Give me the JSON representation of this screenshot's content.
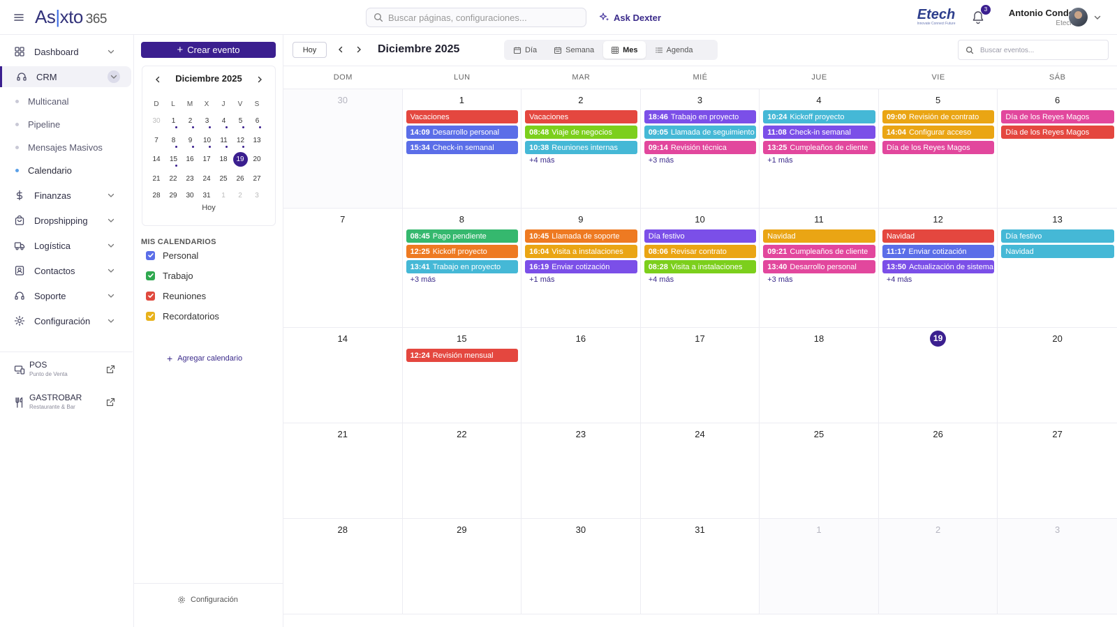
{
  "app": {
    "logo_main": "As",
    "logo_bar": "|",
    "logo_rest": "xto",
    "logo_suffix": "365",
    "search_placeholder": "Buscar páginas, configuraciones...",
    "ask_label": "Ask Dexter",
    "brand_name": "Etech",
    "brand_tagline": "Innovate Connect Future",
    "notifications": "3",
    "user_name": "Antonio Conde",
    "user_company": "Etech"
  },
  "sidebar": {
    "items": [
      {
        "label": "Dashboard",
        "icon": "dashboard-icon"
      },
      {
        "label": "CRM",
        "icon": "headset-icon"
      },
      {
        "label": "Finanzas",
        "icon": "dollar-icon"
      },
      {
        "label": "Dropshipping",
        "icon": "bag-icon"
      },
      {
        "label": "Logística",
        "icon": "truck-icon"
      },
      {
        "label": "Contactos",
        "icon": "contacts-icon"
      },
      {
        "label": "Soporte",
        "icon": "headset-icon"
      },
      {
        "label": "Configuración",
        "icon": "gear-icon"
      }
    ],
    "crm_sub": [
      "Multicanal",
      "Pipeline",
      "Mensajes Masivos",
      "Calendario"
    ],
    "external": [
      {
        "title": "POS",
        "subtitle": "Punto de Venta"
      },
      {
        "title": "GASTROBAR",
        "subtitle": "Restaurante & Bar"
      }
    ]
  },
  "calendar_panel": {
    "create_label": "Crear evento",
    "mini_title": "Diciembre 2025",
    "weekdays": [
      "D",
      "L",
      "M",
      "X",
      "J",
      "V",
      "S"
    ],
    "days": [
      {
        "d": "30",
        "out": true
      },
      {
        "d": "1",
        "ev": true
      },
      {
        "d": "2",
        "ev": true
      },
      {
        "d": "3",
        "ev": true
      },
      {
        "d": "4",
        "ev": true
      },
      {
        "d": "5",
        "ev": true
      },
      {
        "d": "6",
        "ev": true
      },
      {
        "d": "7"
      },
      {
        "d": "8",
        "ev": true
      },
      {
        "d": "9",
        "ev": true
      },
      {
        "d": "10",
        "ev": true
      },
      {
        "d": "11",
        "ev": true
      },
      {
        "d": "12",
        "ev": true
      },
      {
        "d": "13"
      },
      {
        "d": "14"
      },
      {
        "d": "15",
        "ev": true
      },
      {
        "d": "16"
      },
      {
        "d": "17"
      },
      {
        "d": "18"
      },
      {
        "d": "19",
        "today": true
      },
      {
        "d": "20"
      },
      {
        "d": "21"
      },
      {
        "d": "22"
      },
      {
        "d": "23"
      },
      {
        "d": "24"
      },
      {
        "d": "25"
      },
      {
        "d": "26"
      },
      {
        "d": "27"
      },
      {
        "d": "28"
      },
      {
        "d": "29"
      },
      {
        "d": "30"
      },
      {
        "d": "31"
      },
      {
        "d": "1",
        "out": true
      },
      {
        "d": "2",
        "out": true
      },
      {
        "d": "3",
        "out": true
      }
    ],
    "today_label": "Hoy",
    "my_calendars_title": "MIS CALENDARIOS",
    "calendars": [
      {
        "label": "Personal",
        "color": "#5b6ee8"
      },
      {
        "label": "Trabajo",
        "color": "#2fa84f"
      },
      {
        "label": "Reuniones",
        "color": "#e0493e"
      },
      {
        "label": "Recordatorios",
        "color": "#e8b21c"
      }
    ],
    "add_calendar": "Agregar calendario",
    "settings_label": "Configuración"
  },
  "toolbar": {
    "today": "Hoy",
    "title": "Diciembre 2025",
    "views": [
      {
        "label": "Día",
        "icon": "calendar-icon"
      },
      {
        "label": "Semana",
        "icon": "calendar-week-icon"
      },
      {
        "label": "Mes",
        "icon": "grid-icon",
        "active": true
      },
      {
        "label": "Agenda",
        "icon": "list-icon"
      }
    ],
    "search_placeholder": "Buscar eventos..."
  },
  "month": {
    "weekdays": [
      "DOM",
      "LUN",
      "MAR",
      "MIÉ",
      "JUE",
      "VIE",
      "SÁB"
    ],
    "weeks": [
      [
        {
          "d": "30",
          "out": true,
          "events": []
        },
        {
          "d": "1",
          "events": [
            {
              "t": "",
              "title": "Vacaciones",
              "color": "#e4473f"
            },
            {
              "t": "14:09",
              "title": "Desarrollo personal",
              "color": "#5b6ee8"
            },
            {
              "t": "15:34",
              "title": "Check-in semanal",
              "color": "#5b6ee8"
            }
          ]
        },
        {
          "d": "2",
          "events": [
            {
              "t": "",
              "title": "Vacaciones",
              "color": "#e4473f"
            },
            {
              "t": "08:48",
              "title": "Viaje de negocios",
              "color": "#7ccf1c"
            },
            {
              "t": "10:38",
              "title": "Reuniones internas",
              "color": "#45b8d6"
            }
          ],
          "more": "+4 más"
        },
        {
          "d": "3",
          "events": [
            {
              "t": "18:46",
              "title": "Trabajo en proyecto",
              "color": "#7b4fe8"
            },
            {
              "t": "09:05",
              "title": "Llamada de seguimiento",
              "color": "#45b8d6"
            },
            {
              "t": "09:14",
              "title": "Revisión técnica",
              "color": "#e2479d"
            }
          ],
          "more": "+3 más"
        },
        {
          "d": "4",
          "events": [
            {
              "t": "10:24",
              "title": "Kickoff proyecto",
              "color": "#45b8d6"
            },
            {
              "t": "11:08",
              "title": "Check-in semanal",
              "color": "#7b4fe8"
            },
            {
              "t": "13:25",
              "title": "Cumpleaños de cliente",
              "color": "#e2479d"
            }
          ],
          "more": "+1 más"
        },
        {
          "d": "5",
          "events": [
            {
              "t": "09:00",
              "title": "Revisión de contrato",
              "color": "#eaa514"
            },
            {
              "t": "14:04",
              "title": "Configurar acceso",
              "color": "#eaa514"
            },
            {
              "t": "",
              "title": "Día de los Reyes Magos",
              "color": "#e2479d"
            }
          ]
        },
        {
          "d": "6",
          "events": [
            {
              "t": "",
              "title": "Día de los Reyes Magos",
              "color": "#e2479d"
            },
            {
              "t": "",
              "title": "Día de los Reyes Magos",
              "color": "#e4473f"
            }
          ]
        }
      ],
      [
        {
          "d": "7",
          "events": []
        },
        {
          "d": "8",
          "events": [
            {
              "t": "08:45",
              "title": "Pago pendiente",
              "color": "#35b86e"
            },
            {
              "t": "12:25",
              "title": "Kickoff proyecto",
              "color": "#ee7a22"
            },
            {
              "t": "13:41",
              "title": "Trabajo en proyecto",
              "color": "#45b8d6"
            }
          ],
          "more": "+3 más"
        },
        {
          "d": "9",
          "events": [
            {
              "t": "10:45",
              "title": "Llamada de soporte",
              "color": "#ee7a22"
            },
            {
              "t": "16:04",
              "title": "Visita a instalaciones",
              "color": "#eaa514"
            },
            {
              "t": "16:19",
              "title": "Enviar cotización",
              "color": "#7b4fe8"
            }
          ],
          "more": "+1 más"
        },
        {
          "d": "10",
          "events": [
            {
              "t": "",
              "title": "Día festivo",
              "color": "#7b4fe8"
            },
            {
              "t": "08:06",
              "title": "Revisar contrato",
              "color": "#eaa514"
            },
            {
              "t": "08:28",
              "title": "Visita a instalaciones",
              "color": "#7ccf1c"
            }
          ],
          "more": "+4 más"
        },
        {
          "d": "11",
          "events": [
            {
              "t": "",
              "title": "Navidad",
              "color": "#eaa514"
            },
            {
              "t": "09:21",
              "title": "Cumpleaños de cliente",
              "color": "#e2479d"
            },
            {
              "t": "13:40",
              "title": "Desarrollo personal",
              "color": "#e2479d"
            }
          ],
          "more": "+3 más"
        },
        {
          "d": "12",
          "events": [
            {
              "t": "",
              "title": "Navidad",
              "color": "#e4473f"
            },
            {
              "t": "11:17",
              "title": "Enviar cotización",
              "color": "#5b6ee8"
            },
            {
              "t": "13:50",
              "title": "Actualización de sistema",
              "color": "#7b4fe8"
            }
          ],
          "more": "+4 más"
        },
        {
          "d": "13",
          "events": [
            {
              "t": "",
              "title": "Día festivo",
              "color": "#45b8d6"
            },
            {
              "t": "",
              "title": "Navidad",
              "color": "#45b8d6"
            }
          ]
        }
      ],
      [
        {
          "d": "14",
          "events": []
        },
        {
          "d": "15",
          "events": [
            {
              "t": "12:24",
              "title": "Revisión mensual",
              "color": "#e4473f"
            }
          ]
        },
        {
          "d": "16",
          "events": []
        },
        {
          "d": "17",
          "events": []
        },
        {
          "d": "18",
          "events": []
        },
        {
          "d": "19",
          "today": true,
          "events": []
        },
        {
          "d": "20",
          "events": []
        }
      ],
      [
        {
          "d": "21",
          "events": []
        },
        {
          "d": "22",
          "events": []
        },
        {
          "d": "23",
          "events": []
        },
        {
          "d": "24",
          "events": []
        },
        {
          "d": "25",
          "events": []
        },
        {
          "d": "26",
          "events": []
        },
        {
          "d": "27",
          "events": []
        }
      ],
      [
        {
          "d": "28",
          "events": []
        },
        {
          "d": "29",
          "events": []
        },
        {
          "d": "30",
          "events": []
        },
        {
          "d": "31",
          "events": []
        },
        {
          "d": "1",
          "out": true,
          "events": []
        },
        {
          "d": "2",
          "out": true,
          "events": []
        },
        {
          "d": "3",
          "out": true,
          "events": []
        }
      ]
    ]
  }
}
